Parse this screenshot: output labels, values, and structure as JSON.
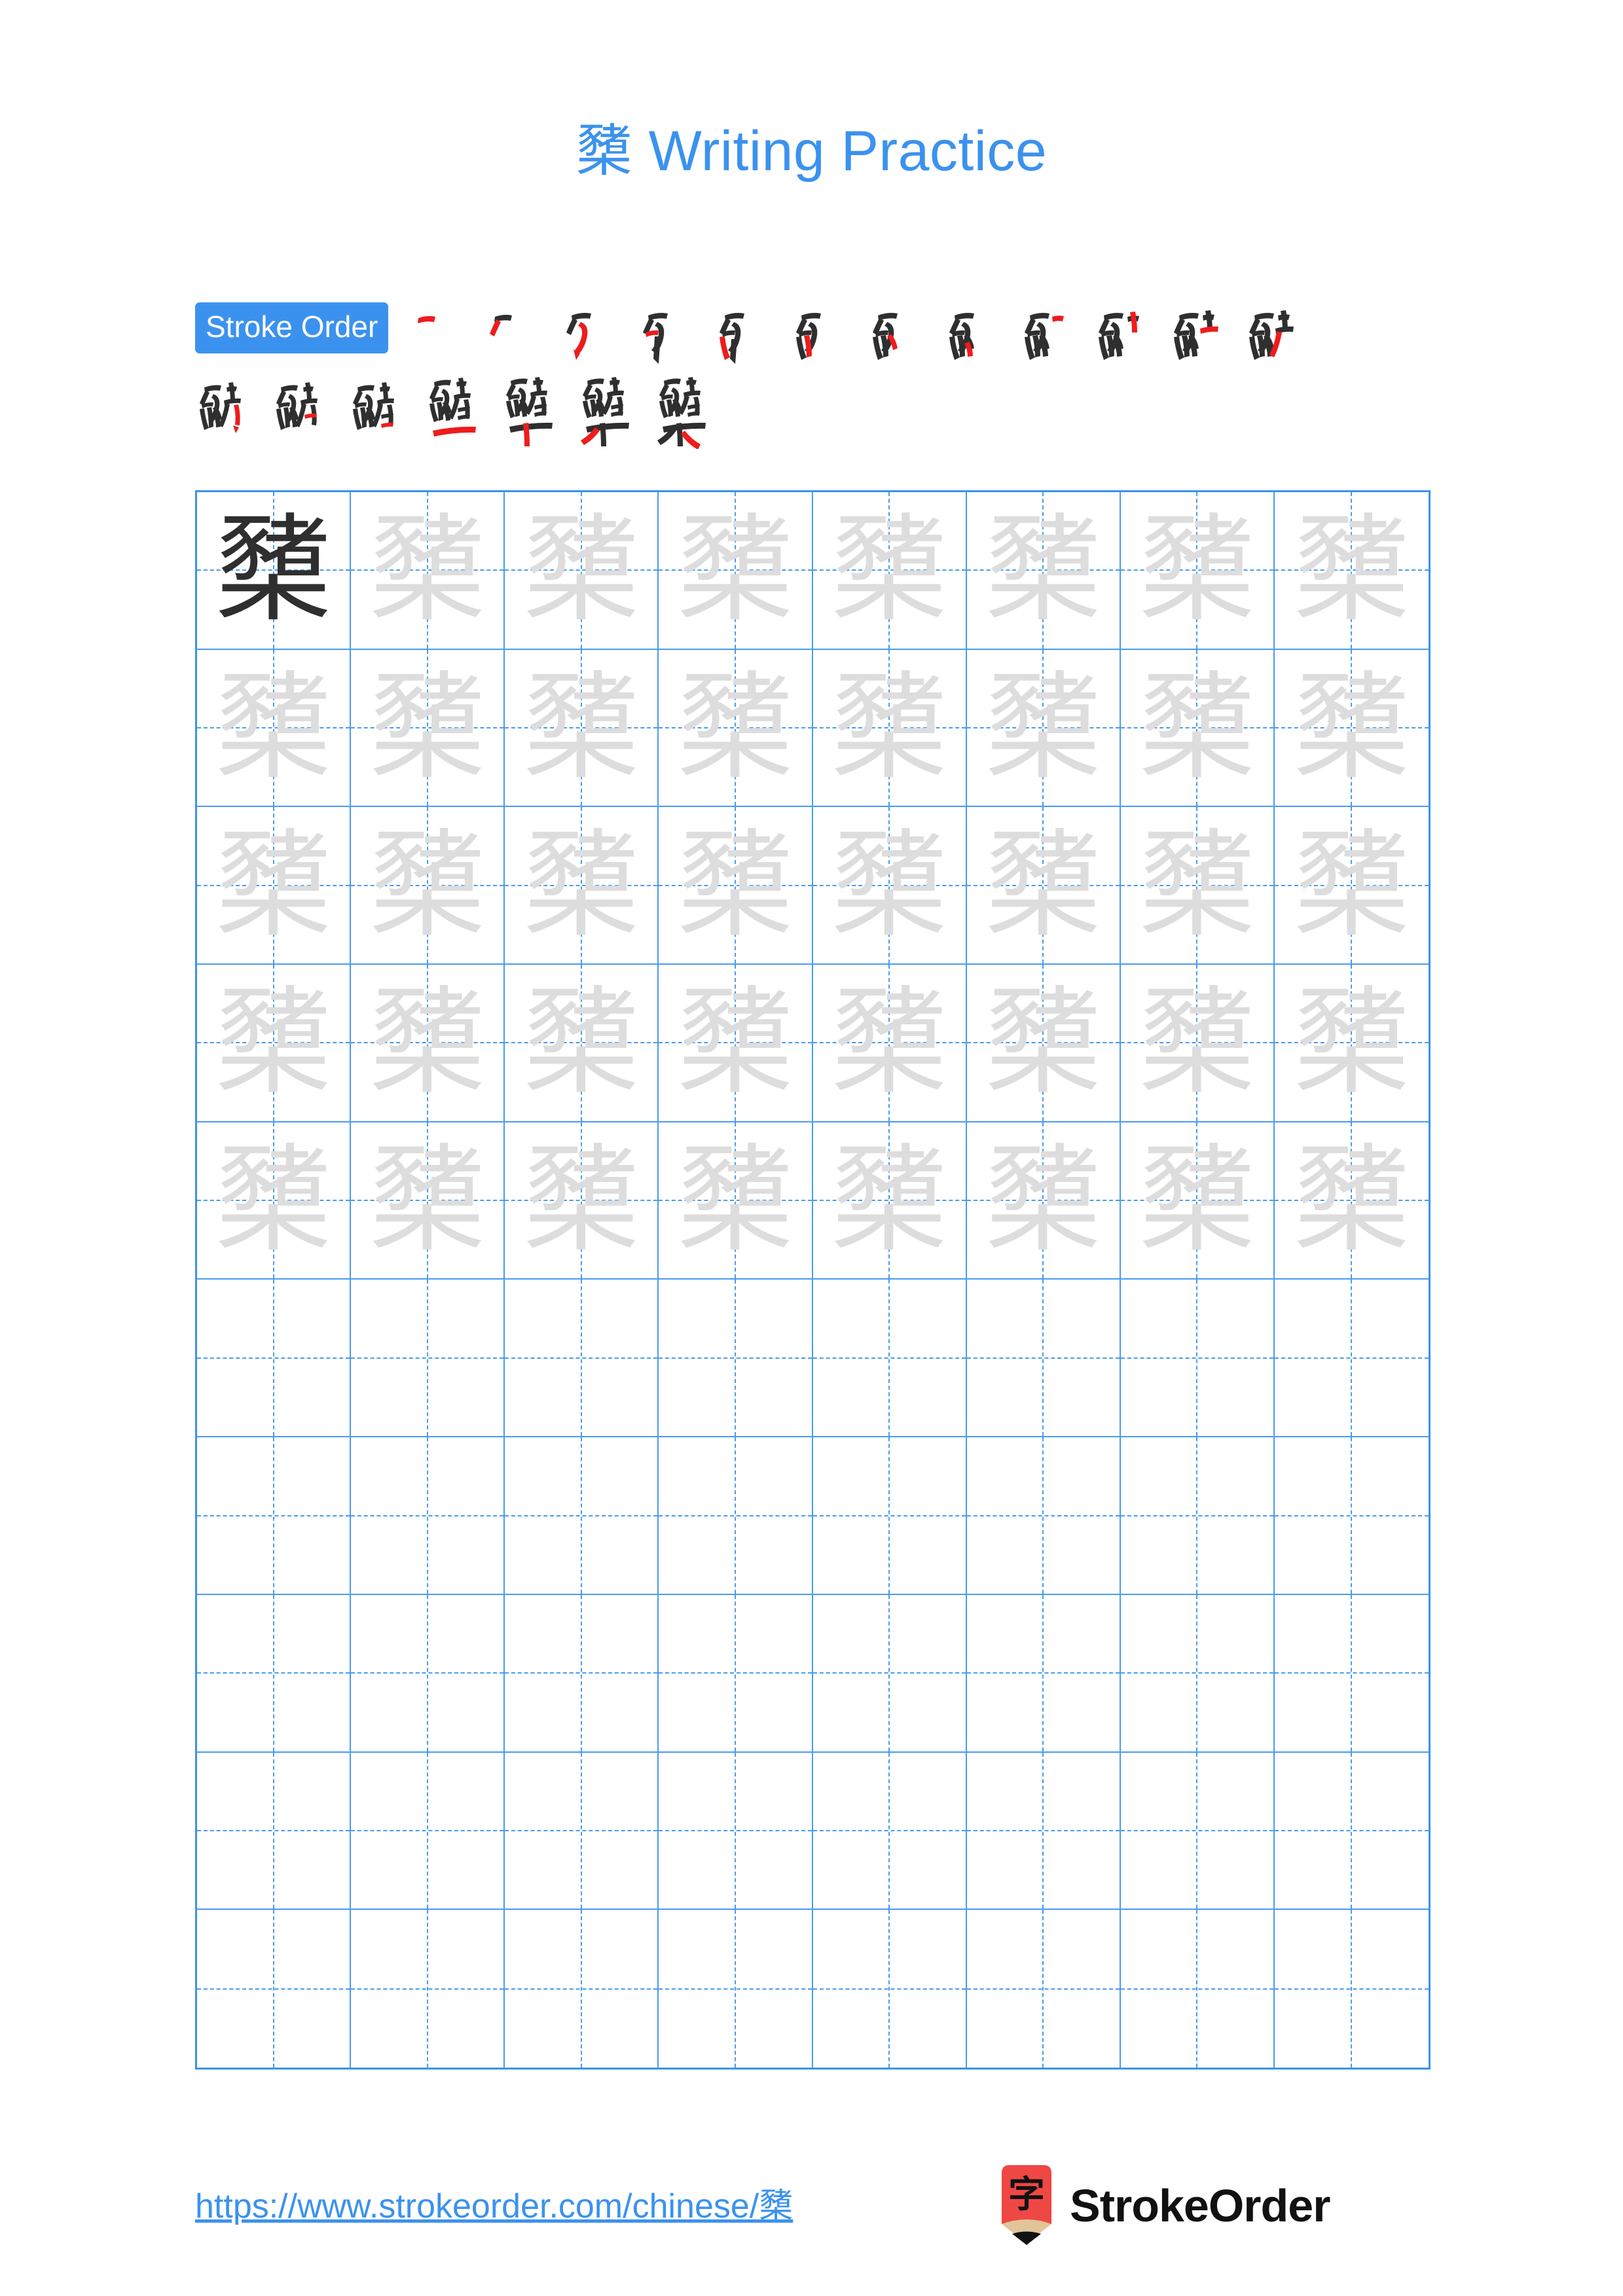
{
  "page": {
    "character": "櫫",
    "title_suffix": " Writing Practice",
    "title_full": "櫫 Writing Practice",
    "accent_color": "#3B92EE",
    "grid_line_color": "#4A9BEF",
    "trace_color": "#dddddd",
    "model_color": "#2f2f2f",
    "new_stroke_color": "#ee1c1c",
    "logo_red": "#EF4744",
    "logo_wood": "#E2C49A"
  },
  "stroke_order": {
    "badge_label": "Stroke Order",
    "total_strokes": 19,
    "row1_count": 12,
    "row2_count": 7,
    "steps": [
      {
        "index": 1,
        "partial": "一"
      },
      {
        "index": 2,
        "partial": "𠂊"
      },
      {
        "index": 3,
        "partial": "豕"
      },
      {
        "index": 4,
        "partial": "豕"
      },
      {
        "index": 5,
        "partial": "豕"
      },
      {
        "index": 6,
        "partial": "豕"
      },
      {
        "index": 7,
        "partial": "豕"
      },
      {
        "index": 8,
        "partial": "豕"
      },
      {
        "index": 9,
        "partial": "豕"
      },
      {
        "index": 10,
        "partial": "豖"
      },
      {
        "index": 11,
        "partial": "豖"
      },
      {
        "index": 12,
        "partial": "豖"
      },
      {
        "index": 13,
        "partial": "豬"
      },
      {
        "index": 14,
        "partial": "豬"
      },
      {
        "index": 15,
        "partial": "豬"
      },
      {
        "index": 16,
        "partial": "豬"
      },
      {
        "index": 17,
        "partial": "櫫"
      },
      {
        "index": 18,
        "partial": "櫫"
      },
      {
        "index": 19,
        "partial": "櫫"
      }
    ]
  },
  "grid": {
    "columns": 8,
    "rows": 10,
    "model_cell": {
      "row": 1,
      "col": 1,
      "glyph": "櫫"
    },
    "trace_glyph": "櫫",
    "trace_rows": 5,
    "blank_rows": 5
  },
  "footer": {
    "url": "https://www.strokeorder.com/chinese/櫫",
    "brand_name": "StrokeOrder",
    "logo_glyph": "字"
  }
}
